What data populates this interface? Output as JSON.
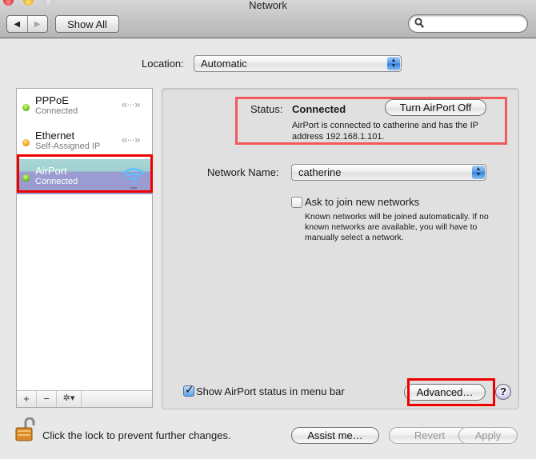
{
  "window": {
    "title": "Network",
    "traffic_lights": [
      "close",
      "minimize",
      "zoom"
    ]
  },
  "toolbar": {
    "back_icon": "◀",
    "forward_icon": "▶",
    "show_all_label": "Show All",
    "search_placeholder": "",
    "search_value": ""
  },
  "location": {
    "label": "Location:",
    "value": "Automatic"
  },
  "sidebar": {
    "services": [
      {
        "name": "PPPoE",
        "status": "Connected",
        "indicator": "green",
        "icon": "ethernet-arrows-icon"
      },
      {
        "name": "Ethernet",
        "status": "Self-Assigned IP",
        "indicator": "orange",
        "icon": "ethernet-arrows-icon"
      },
      {
        "name": "AirPort",
        "status": "Connected",
        "indicator": "green",
        "icon": "wifi-icon",
        "selected": true
      }
    ],
    "tools": {
      "add": "+",
      "remove": "−",
      "gear": "✲▾"
    }
  },
  "detail": {
    "status_label": "Status:",
    "status_value": "Connected",
    "turn_off_label": "Turn AirPort Off",
    "status_description": "AirPort is connected to catherine and has the IP address 192.168.1.101.",
    "network_name_label": "Network Name:",
    "network_name_value": "catherine",
    "ask_join_label": "Ask to join new networks",
    "ask_join_checked": false,
    "ask_join_description": "Known networks will be joined automatically. If no known networks are available, you will have to manually select a network.",
    "show_status_label": "Show AirPort status in menu bar",
    "show_status_checked": true,
    "advanced_label": "Advanced…",
    "help_label": "?"
  },
  "footer": {
    "lock_label": "Click the lock to prevent further changes.",
    "assist_label": "Assist me…",
    "revert_label": "Revert",
    "apply_label": "Apply"
  },
  "colors": {
    "highlight_red": "#e00000",
    "selection_purple": "#9a9bd0",
    "status_box": "#f25a5a"
  }
}
